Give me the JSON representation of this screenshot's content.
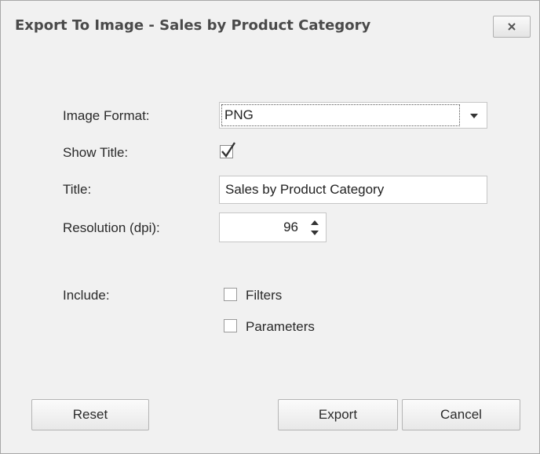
{
  "window": {
    "title": "Export To Image - Sales by Product Category",
    "close_icon": "close-icon"
  },
  "form": {
    "image_format_label": "Image Format:",
    "image_format_value": "PNG",
    "show_title_label": "Show Title:",
    "show_title_checked": true,
    "title_label": "Title:",
    "title_value": "Sales by Product Category",
    "resolution_label": "Resolution (dpi):",
    "resolution_value": "96",
    "include_label": "Include:",
    "include_options": [
      {
        "label": "Filters",
        "checked": false
      },
      {
        "label": "Parameters",
        "checked": false
      }
    ]
  },
  "buttons": {
    "reset": "Reset",
    "export": "Export",
    "cancel": "Cancel"
  }
}
